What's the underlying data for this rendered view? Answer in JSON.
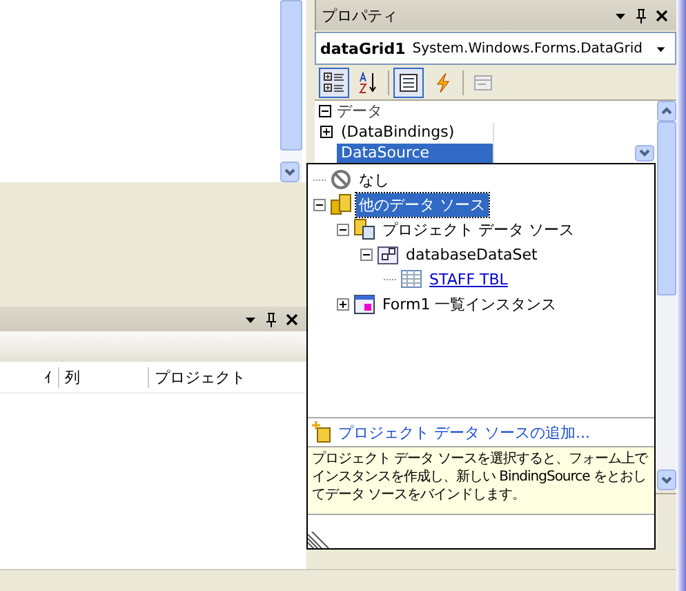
{
  "output_panel": {
    "columns": [
      "ｲ",
      "列",
      "プロジェクト"
    ]
  },
  "properties": {
    "title": "プロパティ",
    "object_name": "dataGrid1",
    "object_type": "System.Windows.Forms.DataGrid",
    "toolbar": [
      {
        "kind": "categorized",
        "selected": true
      },
      {
        "kind": "alphabetical",
        "selected": false
      },
      {
        "kind": "properties",
        "selected": true
      },
      {
        "kind": "events",
        "selected": false
      },
      {
        "kind": "pages",
        "selected": false
      }
    ],
    "category": {
      "label": "データ",
      "expanded": true
    },
    "rows": [
      {
        "name": "(DataBindings)",
        "expandable": true,
        "selected": false
      },
      {
        "name": "DataSource",
        "expandable": false,
        "selected": true
      }
    ]
  },
  "dropdown": {
    "tree": [
      {
        "label": "なし",
        "kind": "none",
        "selected": false
      },
      {
        "label": "他のデータ ソース",
        "kind": "sources",
        "selected": true,
        "expanded": true,
        "children": [
          {
            "label": "プロジェクト データ ソース",
            "kind": "project",
            "selected": false,
            "expanded": true,
            "children": [
              {
                "label": "databaseDataSet",
                "kind": "dataset",
                "selected": false,
                "expanded": true,
                "children": [
                  {
                    "label": "STAFF TBL",
                    "kind": "table",
                    "selected": false
                  }
                ]
              }
            ]
          },
          {
            "label": "Form1 一覧インスタンス",
            "kind": "form",
            "selected": false,
            "expanded": false
          }
        ]
      }
    ],
    "add_link": "プロジェクト データ ソースの追加...",
    "description": "プロジェクト データ ソースを選択すると、フォーム上でインスタンスを作成し、新しい BindingSource をとおしてデータ ソースをバインドします。"
  }
}
